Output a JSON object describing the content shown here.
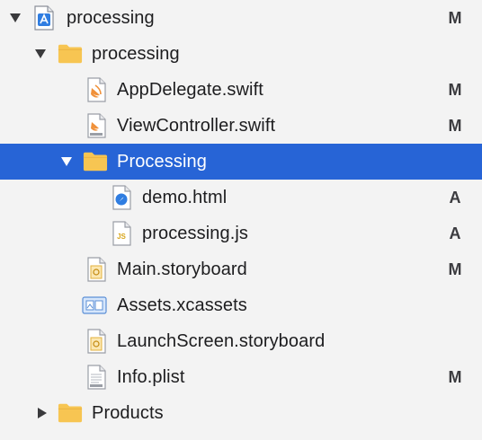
{
  "colors": {
    "background": "#f3f3f3",
    "selection": "#2764d6",
    "folder": "#f7c552",
    "badge": "#3b3b3f"
  },
  "tree": {
    "items": [
      {
        "label": "processing",
        "badge": "M",
        "icon": "xcode-project-icon",
        "disclosure": "expanded"
      },
      {
        "label": "processing",
        "badge": "",
        "icon": "folder-icon",
        "disclosure": "expanded"
      },
      {
        "label": "AppDelegate.swift",
        "badge": "M",
        "icon": "swift-file-icon",
        "disclosure": "none"
      },
      {
        "label": "ViewController.swift",
        "badge": "M",
        "icon": "swift-file-icon",
        "disclosure": "none"
      },
      {
        "label": "Processing",
        "badge": "",
        "icon": "folder-icon",
        "disclosure": "expanded",
        "selected": true
      },
      {
        "label": "demo.html",
        "badge": "A",
        "icon": "html-file-icon",
        "disclosure": "none"
      },
      {
        "label": "processing.js",
        "badge": "A",
        "icon": "js-file-icon",
        "disclosure": "none"
      },
      {
        "label": "Main.storyboard",
        "badge": "M",
        "icon": "storyboard-file-icon",
        "disclosure": "none"
      },
      {
        "label": "Assets.xcassets",
        "badge": "",
        "icon": "asset-catalog-icon",
        "disclosure": "none"
      },
      {
        "label": "LaunchScreen.storyboard",
        "badge": "",
        "icon": "storyboard-file-icon",
        "disclosure": "none"
      },
      {
        "label": "Info.plist",
        "badge": "M",
        "icon": "plist-file-icon",
        "disclosure": "none"
      },
      {
        "label": "Products",
        "badge": "",
        "icon": "folder-icon",
        "disclosure": "collapsed"
      }
    ]
  }
}
